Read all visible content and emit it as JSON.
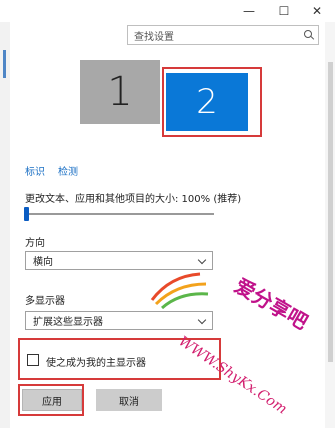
{
  "window": {
    "minimize_glyph": "—",
    "maximize_glyph": "☐",
    "close_glyph": "✕"
  },
  "search": {
    "placeholder": "查找设置",
    "icon": "search-icon"
  },
  "monitors": [
    {
      "label": "1",
      "color": "#a8a8a8",
      "selected": false
    },
    {
      "label": "2",
      "color": "#0a78d7",
      "selected": true
    }
  ],
  "links": {
    "identify": "标识",
    "detect": "检测"
  },
  "scale": {
    "label": "更改文本、应用和其他项目的大小: 100% (推荐)",
    "level_percent": 0
  },
  "orientation": {
    "label": "方向",
    "value": "横向"
  },
  "multiple_displays": {
    "label": "多显示器",
    "value": "扩展这些显示器"
  },
  "main_display": {
    "label": "使之成为我的主显示器",
    "checked": false
  },
  "buttons": {
    "apply": "应用",
    "cancel": "取消"
  },
  "watermark": {
    "text": "爱分享吧",
    "url": "WWW.ShyKx.Com"
  },
  "colors": {
    "accent": "#0a78d7",
    "highlight": "#d63a3a",
    "link": "#1a6fc4"
  }
}
